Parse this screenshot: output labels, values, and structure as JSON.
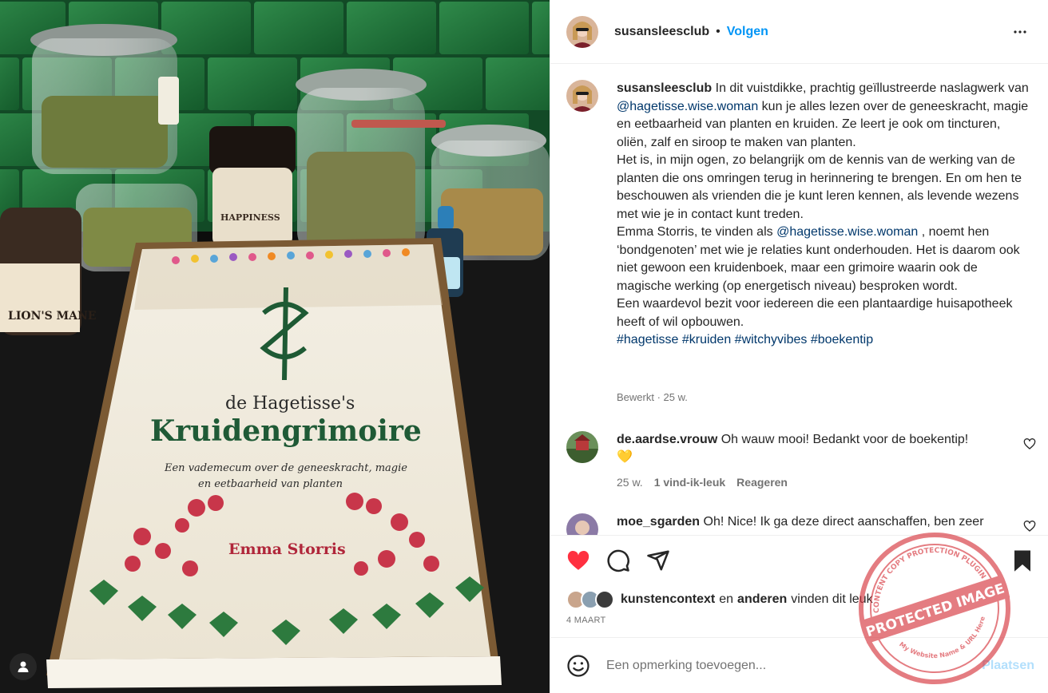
{
  "header": {
    "username": "susansleesclub",
    "dot": "•",
    "follow_label": "Volgen"
  },
  "caption": {
    "username": "susansleesclub",
    "p1_before": "In dit vuistdikke, prachtig geïllustreerde naslagwerk van",
    "p1_mention": "@hagetisse.wise.woman",
    "p1_after": "kun je alles lezen over de geneeskracht, magie en eetbaarheid van planten en kruiden. Ze leert je ook om tincturen, oliën, zalf en siroop te maken van planten.",
    "p2": "Het is, in mijn ogen, zo belangrijk om de kennis van de werking van de planten die ons omringen terug in herinnering te brengen. En om hen te beschouwen als vrienden die je kunt leren kennen, als levende wezens met wie je in contact kunt treden.",
    "p3_before": "Emma Storris, te vinden als",
    "p3_mention": "@hagetisse.wise.woman",
    "p3_after": ", noemt hen ‘bondgenoten’ met wie je relaties kunt onderhouden. Het is daarom ook niet gewoon een kruidenboek, maar een grimoire waarin ook de magische werking (op energetisch niveau) besproken wordt.",
    "p4": "Een waardevol bezit voor iedereen die een plantaardige huisapotheek heeft of wil opbouwen.",
    "hashtags": [
      "#hagetisse",
      "#kruiden",
      "#witchyvibes",
      "#boekentip"
    ],
    "meta": "Bewerkt · 25 w."
  },
  "comments": [
    {
      "username": "de.aardse.vrouw",
      "text": "Oh wauw mooi! Bedankt voor de boekentip!",
      "emoji": "💛",
      "age": "25 w.",
      "likes": "1 vind-ik-leuk",
      "reply": "Reageren"
    },
    {
      "username": "moe_sgarden",
      "text": "Oh! Nice! Ik ga deze direct aanschaffen, ben zeer"
    }
  ],
  "likes": {
    "first_user": "kunstencontext",
    "and_text": "en",
    "others": "anderen",
    "suffix": "vinden dit leuk",
    "date": "4 MAART"
  },
  "add_comment": {
    "placeholder": "Een opmerking toevoegen...",
    "post_label": "Plaatsen"
  },
  "book": {
    "title_line1": "de Hagetisse's",
    "title_line2": "Kruidengrimoire",
    "subtitle_line1": "Een vademecum over de geneeskracht, magie",
    "subtitle_line2": "en eetbaarheid van planten",
    "author": "Emma Storris"
  },
  "jar_labels": {
    "lions_mane": "LION'S MANE",
    "happiness": "HAPPINESS"
  },
  "watermark": {
    "line1": "PROTECTED IMAGE",
    "line2": "CONTENT COPY PROTECTION PLUGIN",
    "line3": "My Website Name & URL Here"
  },
  "colors": {
    "accent": "#0095f6",
    "like_red": "#ff3040",
    "link": "#00376b",
    "muted": "#737373",
    "tile_green": "#1f6b3a"
  }
}
